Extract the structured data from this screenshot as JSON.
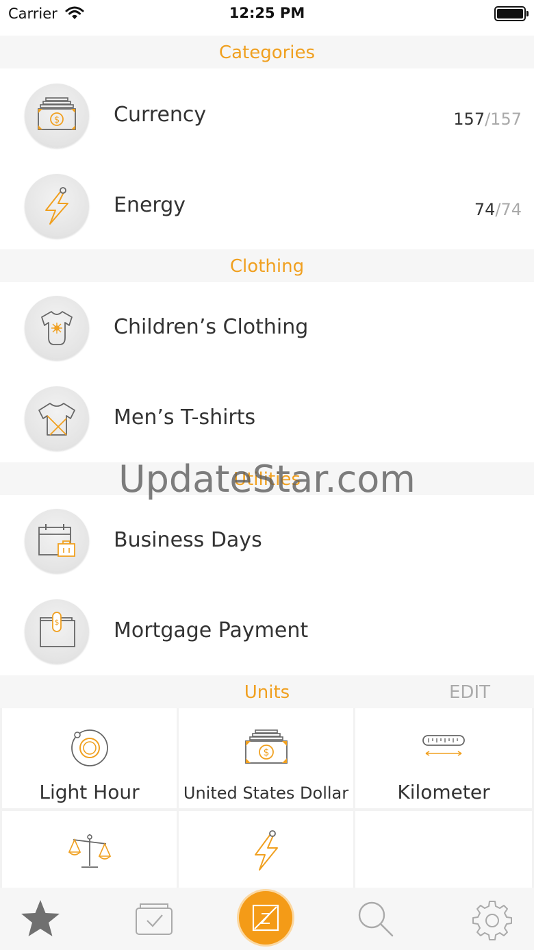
{
  "status_bar": {
    "carrier": "Carrier",
    "time": "12:25 PM"
  },
  "sections": {
    "categories": "Categories",
    "clothing": "Clothing",
    "utilities": "Utilities",
    "units": "Units",
    "units_edit": "EDIT"
  },
  "rows": {
    "currency": {
      "label": "Currency",
      "count": "157",
      "total": "/157",
      "icon": "money-stack-icon"
    },
    "energy": {
      "label": "Energy",
      "count": "74",
      "total": "/74",
      "icon": "lightning-icon"
    },
    "childrens_clothing": {
      "label": "Children’s Clothing",
      "icon": "onesie-icon"
    },
    "mens_tshirts": {
      "label": "Men’s T-shirts",
      "icon": "tshirt-icon"
    },
    "business_days": {
      "label": "Business Days",
      "icon": "calendar-briefcase-icon"
    },
    "mortgage_payment": {
      "label": "Mortgage Payment",
      "icon": "wallet-icon"
    }
  },
  "units": [
    {
      "label": "Light Hour",
      "icon": "orbit-icon"
    },
    {
      "label": "United States Dollar",
      "icon": "money-stack-icon"
    },
    {
      "label": "Kilometer",
      "icon": "ruler-icon"
    },
    {
      "label": "",
      "icon": "scale-icon"
    },
    {
      "label": "",
      "icon": "lightning-icon"
    }
  ],
  "tab_bar": [
    "star-icon",
    "checkbox-icon",
    "converter-icon",
    "search-icon",
    "gear-icon"
  ],
  "watermark": "UpdateStar.com",
  "colors": {
    "accent": "#f49b17",
    "header_bg": "#f6f6f6",
    "muted": "#aaaaaa"
  }
}
